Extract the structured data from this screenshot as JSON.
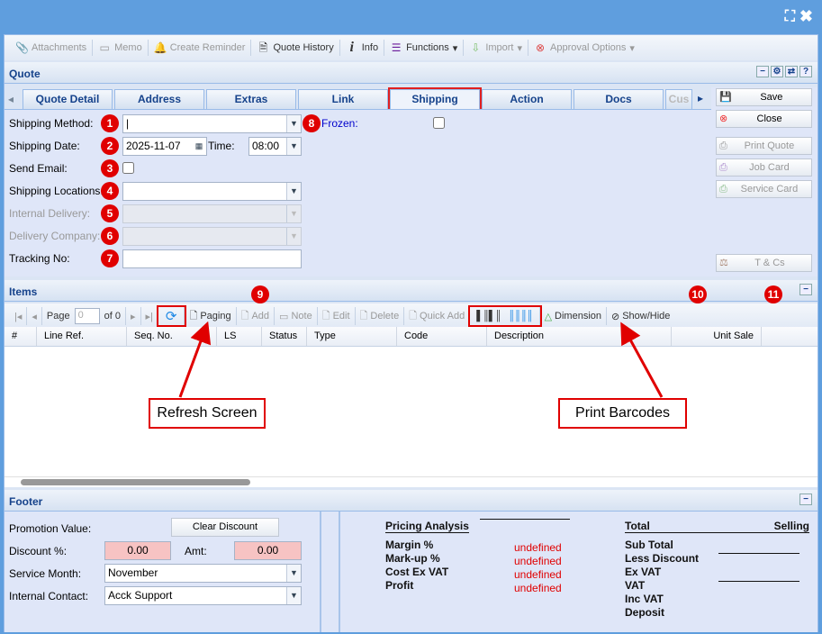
{
  "window": {
    "maximize_icon": "maximize-icon",
    "close_icon": "close-icon"
  },
  "toolbar": [
    {
      "label": "Attachments",
      "icon": "paperclip-icon",
      "disabled": true
    },
    {
      "label": "Memo",
      "icon": "memo-icon",
      "disabled": true
    },
    {
      "label": "Create Reminder",
      "icon": "bell-icon",
      "disabled": true
    },
    {
      "label": "Quote History",
      "icon": "history-icon",
      "disabled": false
    },
    {
      "label": "Info",
      "icon": "info-icon",
      "disabled": false
    },
    {
      "label": "Functions",
      "icon": "menu-icon",
      "disabled": false
    },
    {
      "label": "Import",
      "icon": "import-icon",
      "disabled": true
    },
    {
      "label": "Approval Options",
      "icon": "approval-icon",
      "disabled": true
    }
  ],
  "quote": {
    "title": "Quote",
    "tabs": [
      "Quote Detail",
      "Address",
      "Extras",
      "Link",
      "Shipping",
      "Action",
      "Docs",
      "Cus"
    ],
    "active_tab": "Shipping",
    "form": {
      "shipping_method_label": "Shipping Method:",
      "shipping_method": "",
      "frozen_label": "Frozen:",
      "shipping_date_label": "Shipping Date:",
      "shipping_date": "2025-11-07",
      "time_label": "Time:",
      "time": "08:00",
      "send_email_label": "Send Email:",
      "shipping_locations_label": "Shipping Locations:",
      "shipping_locations": "",
      "internal_delivery_label": "Internal Delivery:",
      "delivery_company_label": "Delivery Company:",
      "tracking_no_label": "Tracking No:",
      "tracking_no": ""
    },
    "buttons": {
      "save": "Save",
      "close": "Close",
      "print_quote": "Print Quote",
      "job_card": "Job Card",
      "service_card": "Service Card",
      "tcs": "T & Cs"
    }
  },
  "items": {
    "title": "Items",
    "page_label": "Page",
    "page": "0",
    "of": "of 0",
    "paging": "Paging",
    "add": "Add",
    "note": "Note",
    "edit": "Edit",
    "delete": "Delete",
    "quick_add": "Quick Add",
    "dimension": "Dimension",
    "show_hide": "Show/Hide",
    "columns": [
      "#",
      "Line Ref.",
      "Seq. No.",
      "LS",
      "Status",
      "Type",
      "Code",
      "Description",
      "Unit Sale"
    ]
  },
  "annotations": {
    "numbers": [
      "1",
      "2",
      "3",
      "4",
      "5",
      "6",
      "7",
      "8",
      "9",
      "10",
      "11"
    ],
    "refresh": "Refresh Screen",
    "barcodes": "Print Barcodes"
  },
  "footer": {
    "title": "Footer",
    "promotion_label": "Promotion Value:",
    "clear_discount": "Clear Discount",
    "discount_label": "Discount %:",
    "discount": "0.00",
    "amt_label": "Amt:",
    "amt": "0.00",
    "service_month_label": "Service Month:",
    "service_month": "November",
    "internal_contact_label": "Internal Contact:",
    "internal_contact": "Acck Support",
    "pricing_title": "Pricing Analysis",
    "pricing": [
      {
        "label": "Margin %",
        "value": "undefined"
      },
      {
        "label": "Mark-up %",
        "value": "undefined"
      },
      {
        "label": "Cost Ex VAT",
        "value": "undefined"
      },
      {
        "label": "Profit",
        "value": "undefined"
      }
    ],
    "total_title": "Total",
    "selling_title": "Selling",
    "totals": [
      "Sub Total",
      "Less Discount",
      "Ex VAT",
      "VAT",
      "Inc VAT",
      "Deposit"
    ]
  },
  "colors": {
    "accent": "#15428b",
    "annotation": "#e00000",
    "frame": "#5f9ede"
  }
}
